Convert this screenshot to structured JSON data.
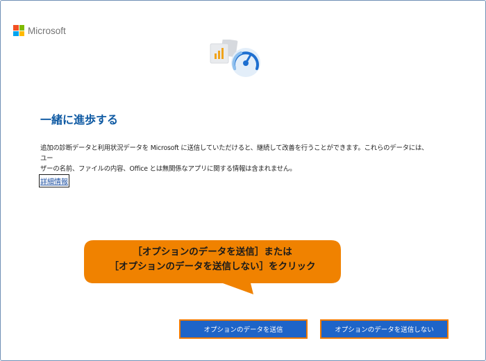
{
  "brand": {
    "name": "Microsoft",
    "logo_colors": [
      "#f25022",
      "#7fba00",
      "#00a4ef",
      "#ffb900"
    ]
  },
  "hero_icon": "diagnostic-gauge-illustration",
  "heading": "一緒に進歩する",
  "description": {
    "line1": "追加の診断データと利用状況データを Microsoft に送信していただけると、継続して改善を行うことができます。これらのデータには、ユー",
    "line2": "ザーの名前、ファイルの内容、Office とは無関係なアプリに関する情報は含まれません。"
  },
  "details_link": "詳細情報",
  "callout": {
    "line1": "［オプションのデータを送信］または",
    "line2": "［オプションのデータを送信しない］をクリック",
    "color": "#f08200"
  },
  "buttons": {
    "send": "オプションのデータを送信",
    "no_send": "オプションのデータを送信しない"
  },
  "colors": {
    "accent": "#1e64c8",
    "heading": "#0f5aa3",
    "highlight_border": "#f07800"
  }
}
